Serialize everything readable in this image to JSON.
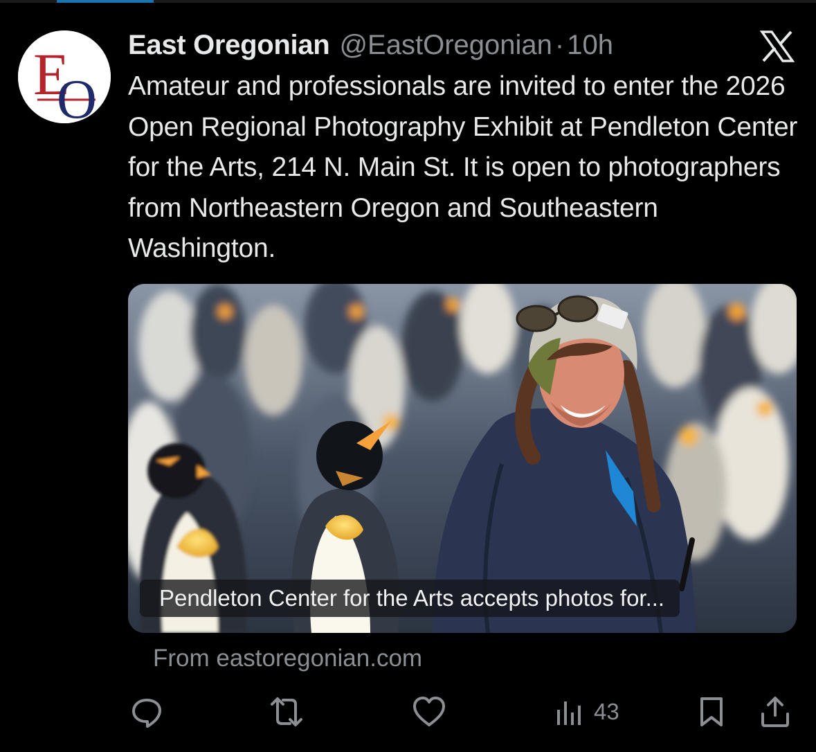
{
  "author": {
    "display_name": "East Oregonian",
    "handle": "@EastOregonian",
    "separator": "·",
    "time": "10h",
    "avatar_letters": [
      "E",
      "O"
    ]
  },
  "tweet": {
    "text": "Amateur and professionals are invited to enter the 2026 Open Regional Photography Exhibit at Pendleton Center for the Arts, 214 N. Main St. It is open to photographers from Northeastern Oregon and Southeastern Washington."
  },
  "link_card": {
    "caption": "Pendleton Center for the Arts accepts photos for...",
    "source": "From eastoregonian.com"
  },
  "actions": {
    "reply_icon": "reply-icon",
    "retweet_icon": "retweet-icon",
    "like_icon": "heart-icon",
    "views_icon": "views-icon",
    "views_count": "43",
    "bookmark_icon": "bookmark-icon",
    "share_icon": "share-icon"
  },
  "colors": {
    "background": "#000000",
    "primary_text": "#e7e9ea",
    "secondary_text": "#8b8f93",
    "logo_red": "#b3242b",
    "logo_blue": "#1f2a6b"
  }
}
